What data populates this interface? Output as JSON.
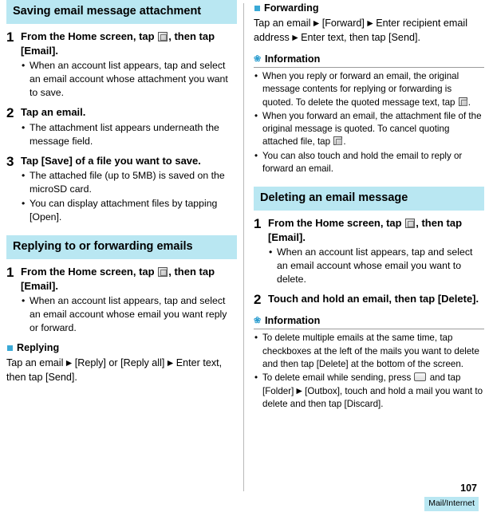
{
  "page": {
    "number": "107",
    "footer_tag": "Mail/Internet"
  },
  "left": {
    "section1": {
      "title": "Saving email message attachment",
      "steps": [
        {
          "num": "1",
          "title_pre": "From the Home screen, tap",
          "title_post": ", then tap [Email].",
          "bullets": [
            "When an account list appears, tap and select an email account whose attachment you want to save."
          ]
        },
        {
          "num": "2",
          "title": "Tap an email.",
          "bullets": [
            "The attachment list appears underneath the message field."
          ]
        },
        {
          "num": "3",
          "title": "Tap [Save] of a file you want to save.",
          "bullets": [
            "The attached file (up to 5MB) is saved on the microSD card.",
            "You can display attachment files by tapping [Open]."
          ]
        }
      ]
    },
    "section2": {
      "title": "Replying to or forwarding emails",
      "steps": [
        {
          "num": "1",
          "title_pre": "From the Home screen, tap",
          "title_post": ", then tap [Email].",
          "bullets": [
            "When an account list appears, tap and select an email account whose email you want reply or forward."
          ]
        }
      ],
      "subhead": "Replying",
      "para_parts": {
        "p1": "Tap an email",
        "p2": "[Reply] or [Reply all]",
        "p3": "Enter text, then tap [Send]."
      }
    }
  },
  "right": {
    "subhead": "Forwarding",
    "para_parts": {
      "p1": "Tap an email",
      "p2": "[Forward]",
      "p3": "Enter recipient email address",
      "p4": "Enter text, then tap [Send]."
    },
    "info1": {
      "title": "Information",
      "bullets": [
        {
          "pre": "When you reply or forward an email, the original message contents for replying or forwarding is quoted. To delete the quoted message text, tap",
          "post": "."
        },
        {
          "pre": "When you forward an email, the attachment file of the original message is quoted. To cancel quoting attached file, tap",
          "post": "."
        },
        {
          "pre": "You can also touch and hold the email to reply or forward an email.",
          "post": ""
        }
      ]
    },
    "section": {
      "title": "Deleting an email message",
      "steps": [
        {
          "num": "1",
          "title_pre": "From the Home screen, tap",
          "title_post": ", then tap [Email].",
          "bullets": [
            "When an account list appears, tap and select an email account whose email you want to delete."
          ]
        },
        {
          "num": "2",
          "title": "Touch and hold an email, then tap [Delete].",
          "bullets": []
        }
      ]
    },
    "info2": {
      "title": "Information",
      "bullets": [
        {
          "pre": "To delete multiple emails at the same time, tap checkboxes at the left of the mails you want to delete and then tap [Delete] at the bottom of the screen.",
          "post": ""
        },
        {
          "pre": "To delete email while sending, press",
          "mid": "and tap [Folder]",
          "post": "[Outbox], touch and hold a mail you want to delete and then tap [Discard]."
        }
      ]
    }
  },
  "symbols": {
    "arrow": "▶",
    "flower": "❀"
  }
}
